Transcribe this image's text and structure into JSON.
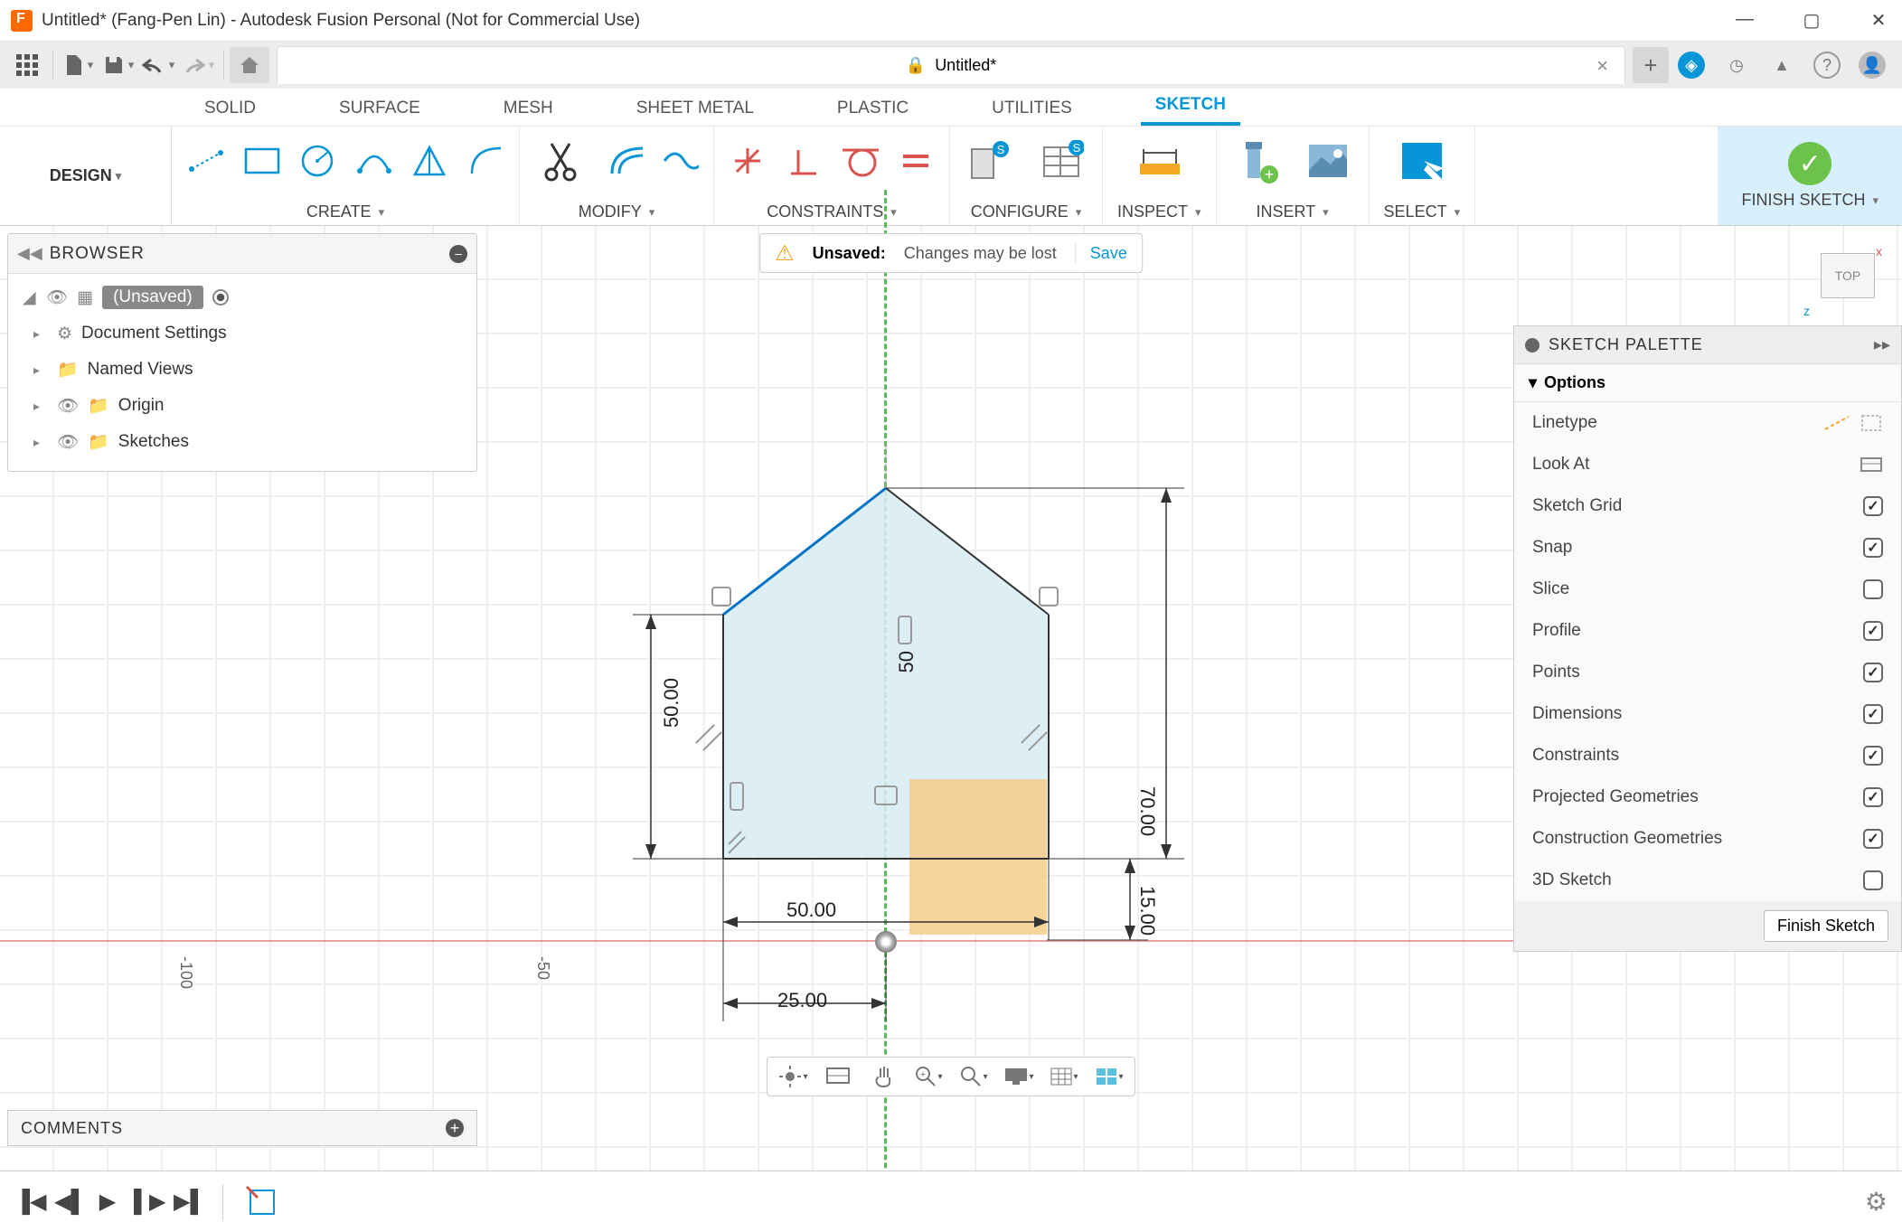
{
  "window": {
    "title": "Untitled* (Fang-Pen Lin) - Autodesk Fusion Personal (Not for Commercial Use)"
  },
  "doc_tab": {
    "label": "Untitled*"
  },
  "workspace_tabs": {
    "solid": "SOLID",
    "surface": "SURFACE",
    "mesh": "MESH",
    "sheet_metal": "SHEET METAL",
    "plastic": "PLASTIC",
    "utilities": "UTILITIES",
    "sketch": "SKETCH"
  },
  "design_label": "DESIGN",
  "ribbon": {
    "create": "CREATE",
    "modify": "MODIFY",
    "constraints": "CONSTRAINTS",
    "configure": "CONFIGURE",
    "inspect": "INSPECT",
    "insert": "INSERT",
    "select": "SELECT",
    "finish": "FINISH SKETCH"
  },
  "browser": {
    "title": "BROWSER",
    "root": "(Unsaved)",
    "doc_settings": "Document Settings",
    "named_views": "Named Views",
    "origin": "Origin",
    "sketches": "Sketches"
  },
  "banner": {
    "label": "Unsaved:",
    "msg": "Changes may be lost",
    "save": "Save"
  },
  "viewcube": {
    "face": "TOP",
    "x": "x",
    "z": "z"
  },
  "dimensions": {
    "h50": "50.00",
    "v50": "50",
    "w50": "50.00",
    "w25": "25.00",
    "h70": "70.00",
    "h15": "15.00"
  },
  "rulers": {
    "m100": "-100",
    "m50": "-50"
  },
  "palette": {
    "title": "SKETCH PALETTE",
    "options": "Options",
    "linetype": "Linetype",
    "look_at": "Look At",
    "sketch_grid": "Sketch Grid",
    "snap": "Snap",
    "slice": "Slice",
    "profile": "Profile",
    "points": "Points",
    "dims": "Dimensions",
    "constraints": "Constraints",
    "projected": "Projected Geometries",
    "construction": "Construction Geometries",
    "three_d": "3D Sketch",
    "finish_btn": "Finish Sketch"
  },
  "comments": {
    "title": "COMMENTS"
  }
}
